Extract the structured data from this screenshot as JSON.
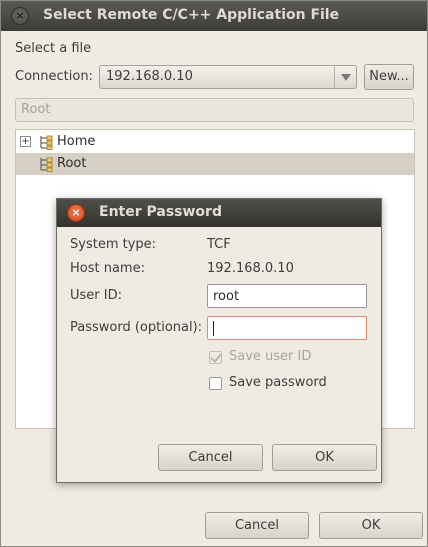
{
  "window": {
    "title": "Select Remote C/C++ Application File",
    "close_glyph": "×"
  },
  "main": {
    "select_label": "Select a file",
    "connection_label": "Connection:",
    "connection_value": "192.168.0.10",
    "new_button": "New...",
    "path_value": "Root",
    "tree": [
      {
        "name": "Home",
        "expander": "+",
        "icon": "folder-icon"
      },
      {
        "name": "Root",
        "icon": "folder-icon",
        "selected": true
      }
    ],
    "cancel_button": "Cancel",
    "ok_button": "OK"
  },
  "dialog": {
    "title": "Enter Password",
    "close_glyph": "×",
    "system_type_label": "System type:",
    "system_type_value": "TCF",
    "host_name_label": "Host name:",
    "host_name_value": "192.168.0.10",
    "user_id_label": "User ID:",
    "user_id_value": "root",
    "password_label": "Password (optional):",
    "password_value": "",
    "save_user_id_label": "Save user ID",
    "save_user_id_checked": true,
    "save_password_label": "Save password",
    "save_password_checked": false,
    "cancel_button": "Cancel",
    "ok_button": "OK"
  },
  "colors": {
    "accent_close": "#cf4a1e",
    "selection": "#d6d0c4",
    "focus_border": "#e08b75"
  }
}
